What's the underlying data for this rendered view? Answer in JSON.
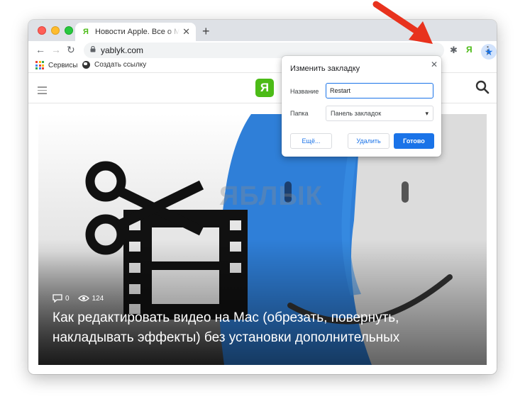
{
  "browser": {
    "tab": {
      "favicon_letter": "Я",
      "title": "Новости Apple. Все о Mac, iPhone",
      "close_glyph": "✕"
    },
    "new_tab_glyph": "+",
    "nav": {
      "back": "←",
      "forward": "→",
      "reload": "↻"
    },
    "omnibox": {
      "url": "yablyk.com"
    },
    "bookmark_star": "★",
    "extensions": {
      "puzzle": "✱",
      "ext_letter": "Я",
      "menu": "⋮"
    },
    "bookmarks_bar": {
      "item1": "Сервисы",
      "item2": "Создать ссылку"
    }
  },
  "site": {
    "logo_letter": "Я",
    "hero": {
      "watermark": "ЯБЛЫК",
      "comments_count": "0",
      "views_count": "124",
      "headline": "Как редактировать видео на Mac (обрезать, повернуть, накладывать эффекты) без установки дополнительных"
    }
  },
  "bookmark_popup": {
    "title": "Изменить закладку",
    "close_glyph": "✕",
    "name_label": "Название",
    "name_value": "Restart",
    "folder_label": "Папка",
    "folder_value": "Панель закладок",
    "dropdown_glyph": "▾",
    "more_button": "Ещё...",
    "delete_button": "Удалить",
    "done_button": "Готово"
  },
  "colors": {
    "accent_blue": "#1a73e8",
    "brand_green": "#4cbb17",
    "arrow_red": "#e8321d",
    "finder_blue": "#2f7fd8"
  }
}
